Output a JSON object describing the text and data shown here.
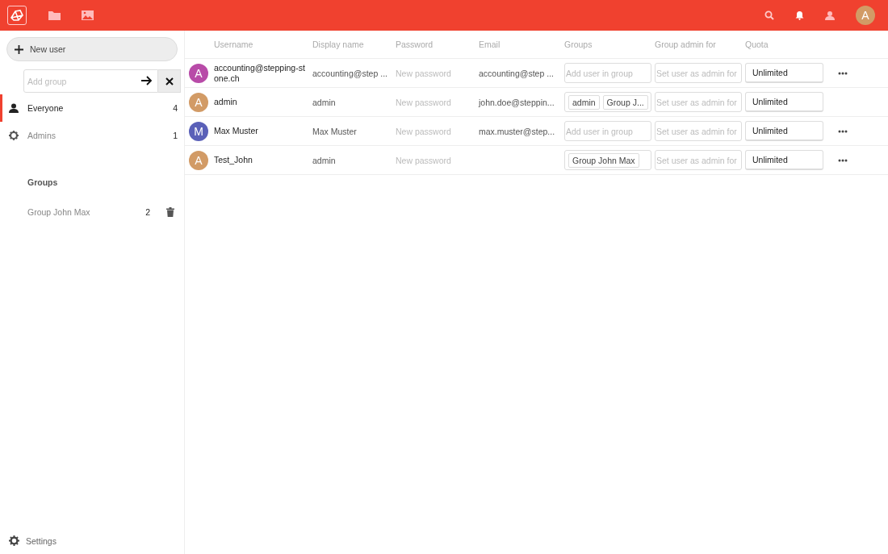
{
  "header": {
    "avatar_letter": "A"
  },
  "sidebar": {
    "new_user": "New user",
    "add_group": {
      "placeholder": "Add group"
    },
    "items": [
      {
        "kind": "everyone",
        "label": "Everyone",
        "count": "4",
        "selected": true
      },
      {
        "kind": "admins",
        "label": "Admins",
        "count": "1",
        "selected": false
      }
    ],
    "groups_heading": "Groups",
    "groups": [
      {
        "label": "Group John Max",
        "count": "2"
      }
    ],
    "settings": "Settings"
  },
  "table": {
    "columns": [
      "Username",
      "Display name",
      "Password",
      "Email",
      "Groups",
      "Group admin for",
      "Quota"
    ],
    "rows": [
      {
        "avatar_letter": "A",
        "color": "#b84ba8",
        "username": "accounting@stepping-stone.ch",
        "display_name": "accounting@step  ...",
        "password": {
          "placeholder": "New password"
        },
        "email": "accounting@step  ...",
        "groups": [],
        "groups_placeholder": "Add user in group",
        "admin_for": {
          "placeholder": "Set user as admin for"
        },
        "quota": "Unlimited",
        "menu": true
      },
      {
        "avatar_letter": "A",
        "color": "#d29b66",
        "username": "admin",
        "display_name": "admin",
        "password": {
          "placeholder": "New password"
        },
        "email": "john.doe@steppin...",
        "groups": [
          "admin",
          "Group J..."
        ],
        "admin_for": {
          "placeholder": "Set user as admin for"
        },
        "quota": "Unlimited",
        "menu": false
      },
      {
        "avatar_letter": "M",
        "color": "#5a60b8",
        "username": "Max Muster",
        "display_name": "Max Muster",
        "password": {
          "placeholder": "New password"
        },
        "email": "max.muster@step...",
        "groups": [],
        "groups_placeholder": "Add user in group",
        "admin_for": {
          "placeholder": "Set user as admin for"
        },
        "quota": "Unlimited",
        "menu": true
      },
      {
        "avatar_letter": "A",
        "color": "#d29b66",
        "username": "Test_John",
        "display_name": "admin",
        "password": {
          "placeholder": "New password"
        },
        "groups": [
          "Group John Max"
        ],
        "admin_for": {
          "placeholder": "Set user as admin for"
        },
        "quota": "Unlimited",
        "menu": true
      }
    ]
  }
}
